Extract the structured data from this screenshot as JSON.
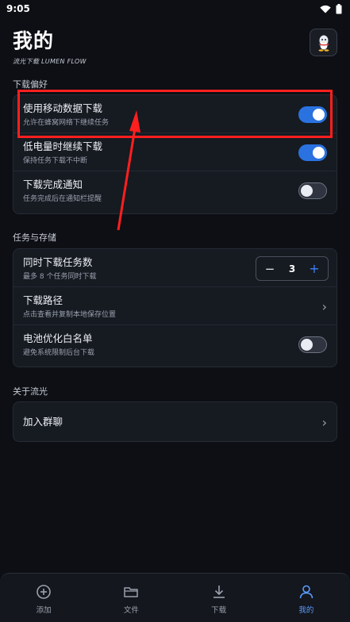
{
  "status_bar": {
    "time": "9:05"
  },
  "header": {
    "title": "我的",
    "subtitle": "流光下载 LUMEN FLOW"
  },
  "sections": {
    "download_prefs": {
      "title": "下载偏好",
      "mobile_data": {
        "title": "使用移动数据下载",
        "subtitle": "允许在蜂窝网络下继续任务",
        "enabled": true
      },
      "low_battery": {
        "title": "低电量时继续下载",
        "subtitle": "保持任务下载不中断",
        "enabled": true
      },
      "complete_notice": {
        "title": "下载完成通知",
        "subtitle": "任务完成后在通知栏提醒",
        "enabled": false
      }
    },
    "tasks_storage": {
      "title": "任务与存储",
      "concurrent": {
        "title": "同时下载任务数",
        "subtitle": "最多 8 个任务同时下载",
        "minus": "−",
        "value": "3",
        "plus": "+"
      },
      "path": {
        "title": "下载路径",
        "subtitle": "点击查看并复制本地保存位置",
        "chevron": "›"
      },
      "battery_whitelist": {
        "title": "电池优化白名单",
        "subtitle": "避免系统限制后台下载",
        "enabled": false
      }
    },
    "about": {
      "title": "关于流光",
      "join_group": {
        "title": "加入群聊",
        "chevron": "›"
      }
    }
  },
  "bottom_nav": {
    "items": [
      {
        "label": "添加",
        "icon": "plus-circle-icon"
      },
      {
        "label": "文件",
        "icon": "folder-icon"
      },
      {
        "label": "下载",
        "icon": "download-icon"
      },
      {
        "label": "我的",
        "icon": "user-icon",
        "active": true
      }
    ]
  },
  "colors": {
    "background": "#0d0f14",
    "accent": "#2a72e0",
    "annotation": "#ff1f1f"
  }
}
